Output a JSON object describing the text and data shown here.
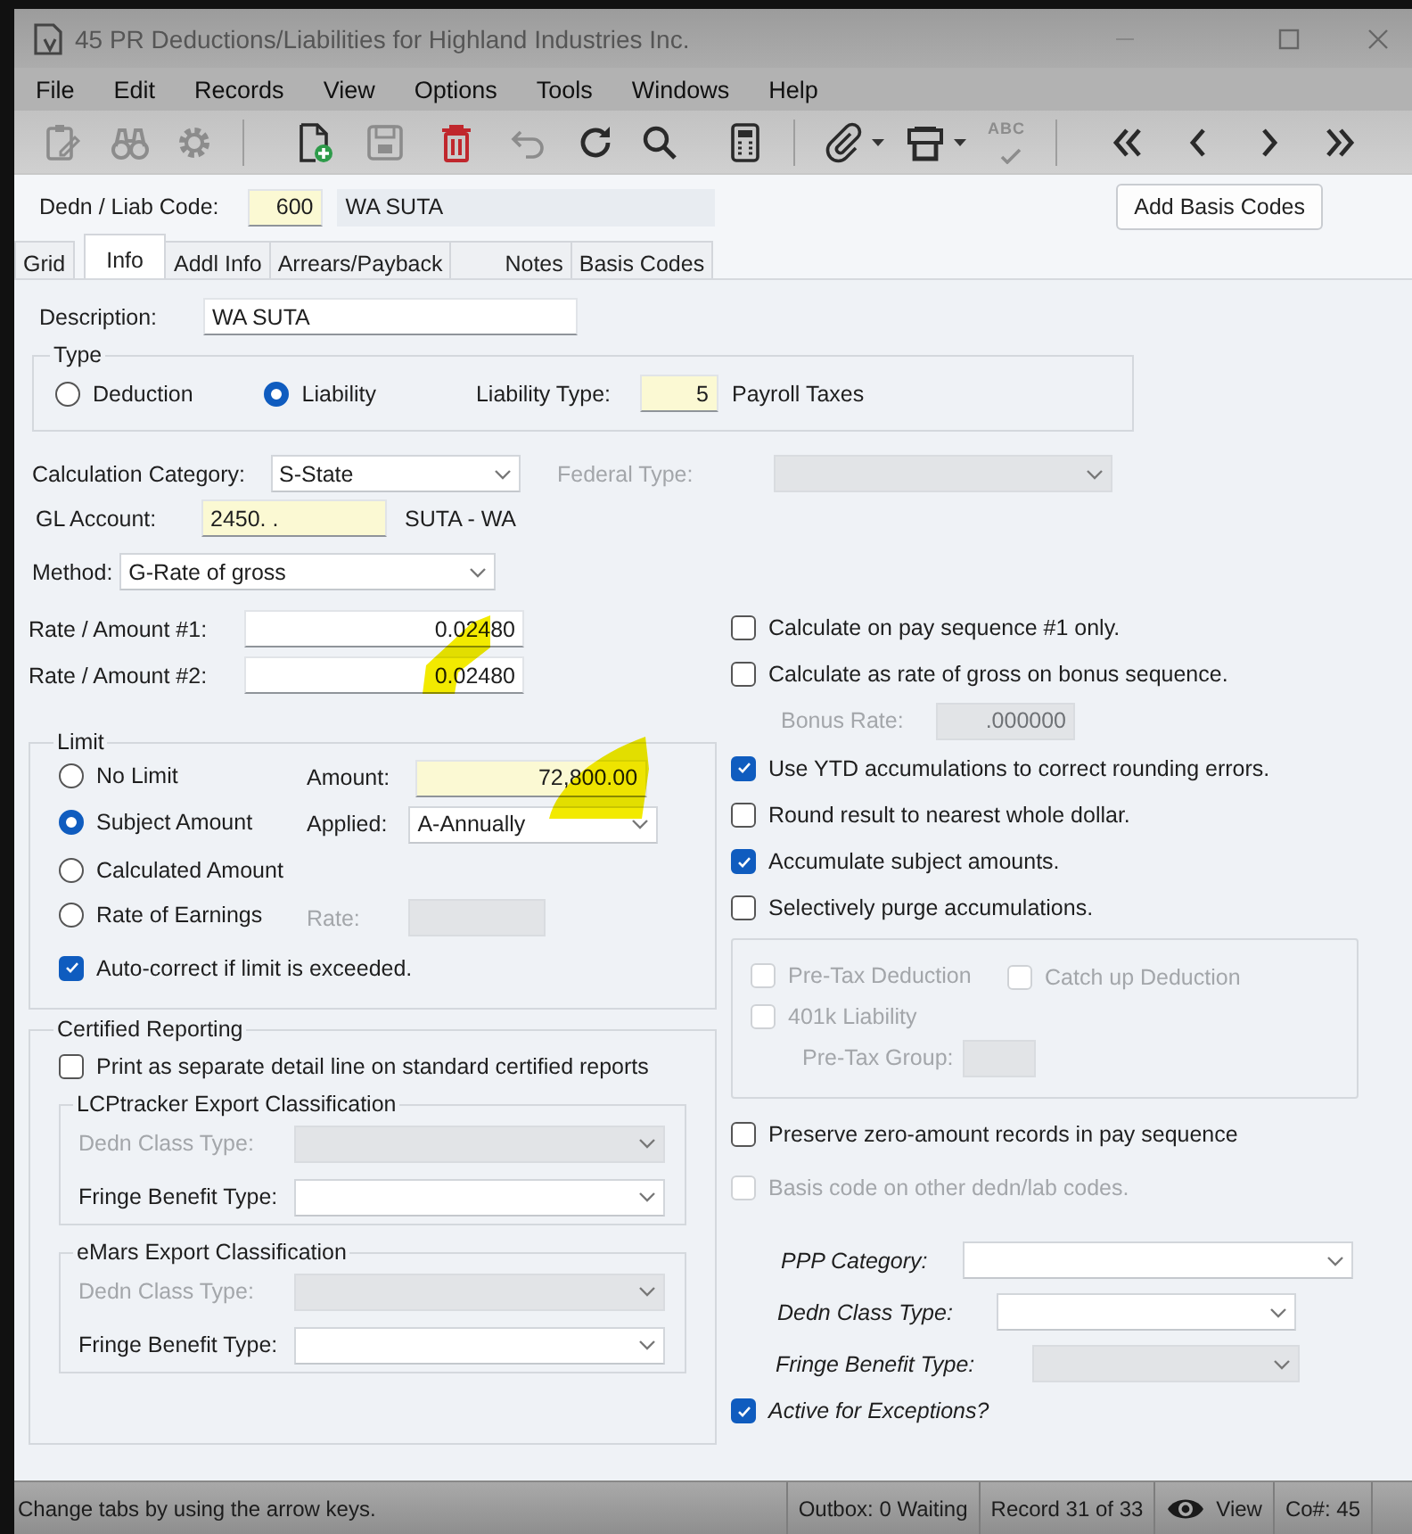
{
  "window": {
    "title": "45 PR Deductions/Liabilities for Highland Industries Inc."
  },
  "menu": [
    "File",
    "Edit",
    "Records",
    "View",
    "Options",
    "Tools",
    "Windows",
    "Help"
  ],
  "toolbar": [
    {
      "enabled": false
    },
    {
      "enabled": false
    },
    {
      "enabled": false
    },
    {
      "enabled": true
    },
    {
      "enabled": false
    },
    {
      "enabled": true
    },
    {
      "enabled": false
    },
    {
      "enabled": true
    },
    {
      "enabled": true
    },
    {
      "enabled": true
    },
    {
      "enabled": true,
      "dropdown": true
    },
    {
      "enabled": true,
      "dropdown": true
    },
    {
      "enabled": false,
      "text": "ABC"
    },
    {
      "enabled": true
    },
    {
      "enabled": true
    },
    {
      "enabled": true
    },
    {
      "enabled": true
    }
  ],
  "header": {
    "code_label": "Dedn / Liab Code:",
    "code": "600",
    "name": "WA SUTA",
    "button": "Add Basis Codes"
  },
  "tabs": [
    {
      "label": "Grid",
      "selected": false
    },
    {
      "label": "Info",
      "selected": true
    },
    {
      "label": "Addl Info",
      "selected": false
    },
    {
      "label": "Arrears/Payback",
      "selected": false
    },
    {
      "label": "Notes",
      "selected": false
    },
    {
      "label": "Basis Codes",
      "selected": false
    }
  ],
  "description": {
    "label": "Description:",
    "value": "WA SUTA"
  },
  "type_group": {
    "title": "Type",
    "options": [
      {
        "label": "Deduction",
        "selected": false
      },
      {
        "label": "Liability",
        "selected": true
      }
    ],
    "liability_type": {
      "label": "Liability Type:",
      "value": "5",
      "name": "Payroll Taxes"
    }
  },
  "calculation_category": {
    "label": "Calculation Category:",
    "value": "S-State"
  },
  "federal_type": {
    "label": "Federal Type:",
    "disabled": true
  },
  "gl_account": {
    "label": "GL Account:",
    "value": "2450.  .",
    "name": "SUTA - WA"
  },
  "method": {
    "label": "Method:",
    "value": "G-Rate of gross"
  },
  "rates": [
    {
      "label": "Rate / Amount #1:",
      "value": "0.02480"
    },
    {
      "label": "Rate / Amount #2:",
      "value": "0.02480"
    }
  ],
  "limit": {
    "title": "Limit",
    "options": [
      {
        "label": "No Limit",
        "selected": false
      },
      {
        "label": "Subject Amount",
        "selected": true
      },
      {
        "label": "Calculated Amount",
        "selected": false
      },
      {
        "label": "Rate of Earnings",
        "selected": false
      }
    ],
    "amount": {
      "label": "Amount:",
      "value": "72,800.00"
    },
    "applied": {
      "label": "Applied:",
      "value": "A-Annually"
    },
    "rate": {
      "label": "Rate:",
      "disabled": true
    },
    "auto_correct": {
      "label": "Auto-correct if limit is exceeded.",
      "checked": true
    }
  },
  "certified": {
    "title": "Certified Reporting",
    "print_separate": {
      "label": "Print as separate detail line on standard certified reports",
      "checked": false
    },
    "sections": [
      {
        "title": "LCPtracker Export Classification",
        "fields": [
          {
            "label": "Dedn Class Type:",
            "disabled": true
          },
          {
            "label": "Fringe Benefit Type:",
            "disabled": false
          }
        ]
      },
      {
        "title": "eMars Export Classification",
        "fields": [
          {
            "label": "Dedn Class Type:",
            "disabled": true
          },
          {
            "label": "Fringe Benefit Type:",
            "disabled": false
          }
        ]
      }
    ]
  },
  "right_items": [
    {
      "kind": "check",
      "label": "Calculate on pay sequence #1 only.",
      "checked": false
    },
    {
      "kind": "check",
      "label": "Calculate as rate of gross on bonus sequence.",
      "checked": false
    },
    {
      "kind": "field",
      "label": "Bonus Rate:",
      "value": ".000000",
      "disabled": true
    },
    {
      "kind": "check",
      "label": "Use YTD accumulations to correct rounding errors.",
      "checked": true
    },
    {
      "kind": "check",
      "label": "Round result to nearest whole dollar.",
      "checked": false
    },
    {
      "kind": "check",
      "label": "Accumulate subject amounts.",
      "checked": true
    },
    {
      "kind": "check",
      "label": "Selectively purge accumulations.",
      "checked": false
    }
  ],
  "pretax": {
    "checks": [
      {
        "label": "Pre-Tax Deduction",
        "checked": false,
        "disabled": true
      },
      {
        "label": "Catch up Deduction",
        "checked": false,
        "disabled": true
      },
      {
        "label": "401k Liability",
        "checked": false,
        "disabled": true
      }
    ],
    "group": {
      "label": "Pre-Tax Group:",
      "disabled": true
    }
  },
  "lower_checks": [
    {
      "label": "Preserve zero-amount records in pay sequence",
      "checked": false,
      "disabled": false
    },
    {
      "label": "Basis code on other dedn/lab codes.",
      "checked": false,
      "disabled": true
    }
  ],
  "extra_fields": [
    {
      "label": "PPP Category:",
      "disabled": false
    },
    {
      "label": "Dedn Class Type:",
      "disabled": false
    },
    {
      "label": "Fringe Benefit Type:",
      "disabled": true
    }
  ],
  "active_exceptions": {
    "label": "Active for Exceptions?",
    "checked": true
  },
  "status_bar": {
    "hint": "Change tabs by using the arrow keys.",
    "outbox": "Outbox: 0 Waiting",
    "record": "Record 31 of 33",
    "mode": "View",
    "company": "Co#: 45"
  }
}
